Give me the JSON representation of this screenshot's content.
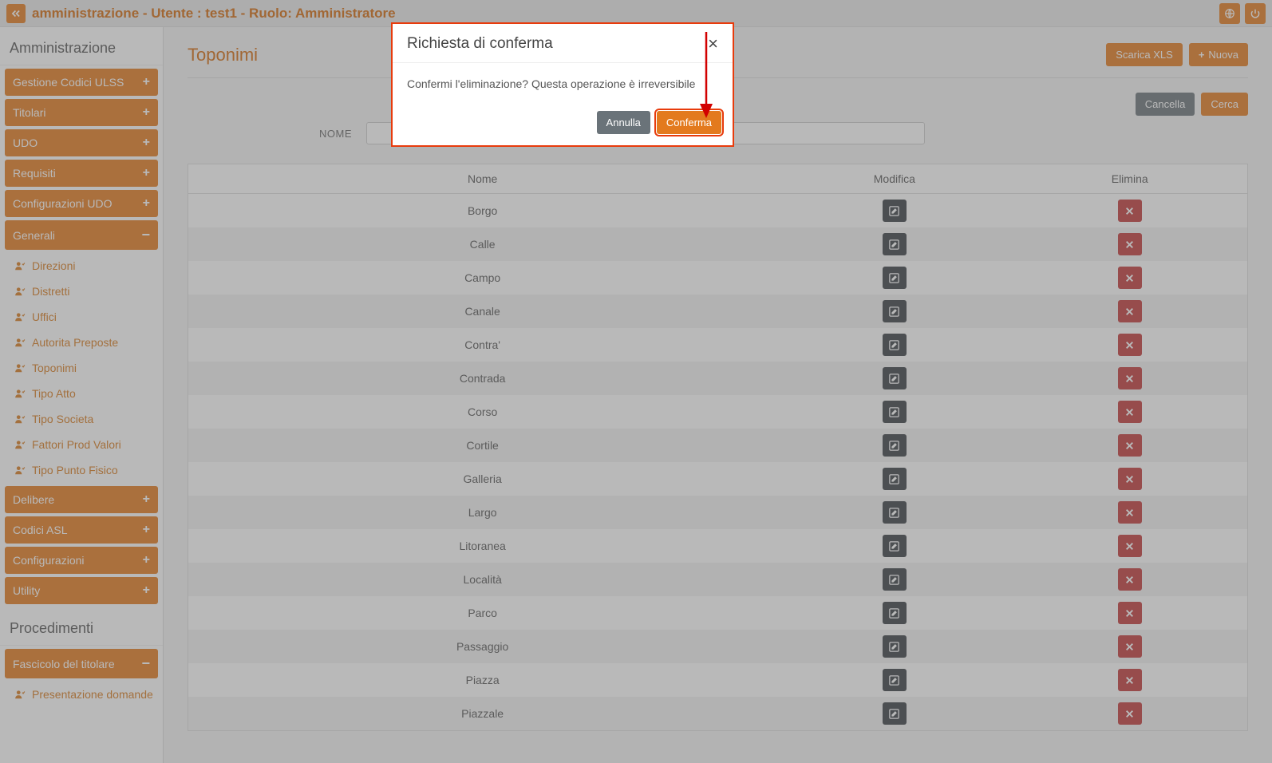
{
  "topbar": {
    "title": "amministrazione - Utente : test1 - Ruolo: Amministratore"
  },
  "sidebar": {
    "section1": "Amministrazione",
    "items": [
      {
        "label": "Gestione Codici ULSS",
        "icon": "plus"
      },
      {
        "label": "Titolari",
        "icon": "plus"
      },
      {
        "label": "UDO",
        "icon": "plus"
      },
      {
        "label": "Requisiti",
        "icon": "plus"
      },
      {
        "label": "Configurazioni UDO",
        "icon": "plus"
      },
      {
        "label": "Generali",
        "icon": "minus",
        "expanded": true,
        "children": [
          "Direzioni",
          "Distretti",
          "Uffici",
          "Autorita Preposte",
          "Toponimi",
          "Tipo Atto",
          "Tipo Societa",
          "Fattori Prod Valori",
          "Tipo Punto Fisico"
        ]
      },
      {
        "label": "Delibere",
        "icon": "plus"
      },
      {
        "label": "Codici ASL",
        "icon": "plus"
      },
      {
        "label": "Configurazioni",
        "icon": "plus"
      },
      {
        "label": "Utility",
        "icon": "plus"
      }
    ],
    "section2": "Procedimenti",
    "items2": [
      {
        "label": "Fascicolo del titolare",
        "icon": "minus",
        "expanded": true,
        "children": [
          "Presentazione domande"
        ]
      }
    ]
  },
  "page": {
    "title": "Toponimi",
    "download_btn": "Scarica XLS",
    "new_btn": "Nuova",
    "cancel_btn": "Cancella",
    "search_btn": "Cerca",
    "name_label": "NOME",
    "name_value": "",
    "columns": {
      "c1": "Nome",
      "c2": "Modifica",
      "c3": "Elimina"
    },
    "rows": [
      {
        "name": "Borgo"
      },
      {
        "name": "Calle"
      },
      {
        "name": "Campo"
      },
      {
        "name": "Canale"
      },
      {
        "name": "Contra'"
      },
      {
        "name": "Contrada"
      },
      {
        "name": "Corso"
      },
      {
        "name": "Cortile"
      },
      {
        "name": "Galleria"
      },
      {
        "name": "Largo"
      },
      {
        "name": "Litoranea"
      },
      {
        "name": "Località"
      },
      {
        "name": "Parco"
      },
      {
        "name": "Passaggio"
      },
      {
        "name": "Piazza"
      },
      {
        "name": "Piazzale"
      }
    ]
  },
  "modal": {
    "title": "Richiesta di conferma",
    "body": "Confermi l'eliminazione? Questa operazione è irreversibile",
    "cancel": "Annulla",
    "confirm": "Conferma"
  }
}
